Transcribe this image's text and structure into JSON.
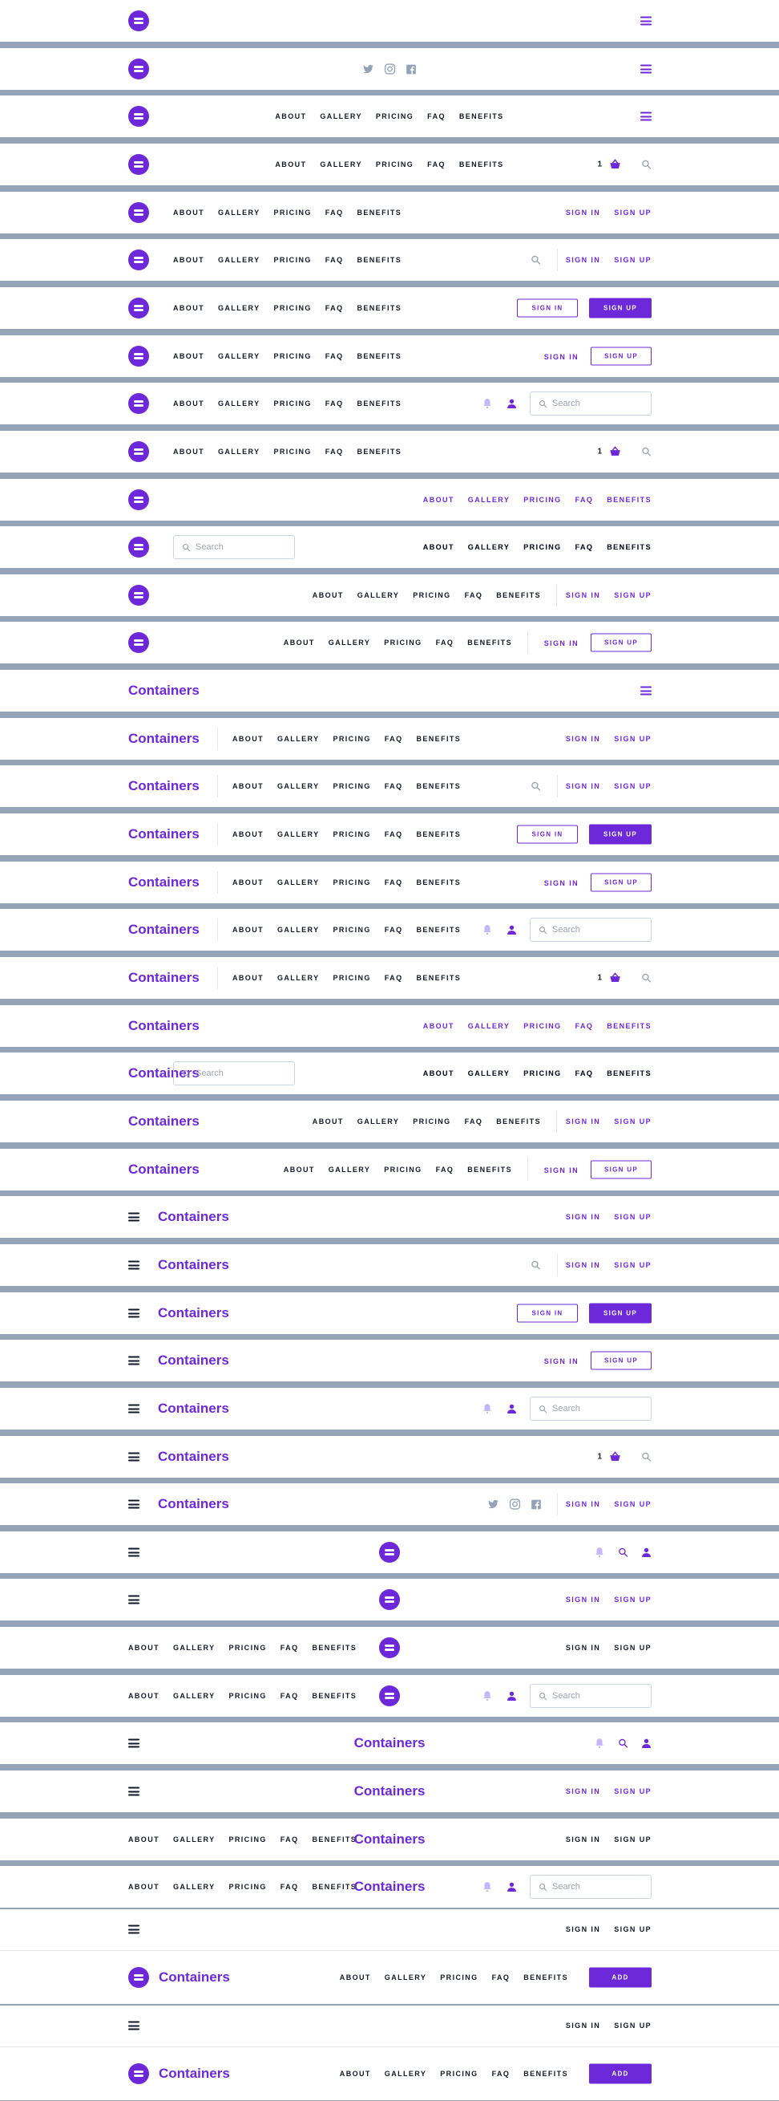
{
  "brand": {
    "name": "Containers"
  },
  "nav": {
    "items": [
      "ABOUT",
      "GALLERY",
      "PRICING",
      "FAQ",
      "BENEFITS"
    ]
  },
  "auth": {
    "sign_in": "SIGN IN",
    "sign_up": "SIGN UP",
    "add": "ADD"
  },
  "search": {
    "placeholder": "Search"
  },
  "cart": {
    "count": "1"
  },
  "icons": [
    "hamburger-icon",
    "twitter-icon",
    "instagram-icon",
    "facebook-icon",
    "cart-icon",
    "search-icon",
    "bell-icon",
    "user-icon"
  ],
  "colors": {
    "accent": "#6d28d9",
    "divider": "#94a3b8",
    "text": "#111827",
    "muted": "#9ca3af"
  },
  "layout_variants": [
    [
      "logo",
      "burger"
    ],
    [
      "logo",
      "social",
      "burger"
    ],
    [
      "logo",
      "menu-center",
      "burger"
    ],
    [
      "logo",
      "menu-center",
      "cart",
      "search"
    ],
    [
      "logo",
      "menu",
      "auth"
    ],
    [
      "logo",
      "menu",
      "search",
      "divider",
      "auth"
    ],
    [
      "logo",
      "menu",
      "btn-outline",
      "btn-filled"
    ],
    [
      "logo",
      "menu",
      "signin",
      "btn-signup"
    ],
    [
      "logo",
      "menu",
      "bell",
      "user",
      "searchbox"
    ],
    [
      "logo",
      "menu",
      "cart",
      "search"
    ],
    [
      "logo",
      "menu-right-purple"
    ],
    [
      "logo",
      "searchbox",
      "menu-right"
    ],
    [
      "logo",
      "menu-right",
      "divider",
      "auth"
    ],
    [
      "logo",
      "menu-right",
      "divider",
      "signin",
      "btn-signup"
    ],
    [
      "brand",
      "burger"
    ],
    [
      "brand",
      "divider",
      "menu",
      "auth"
    ],
    [
      "brand",
      "divider",
      "menu",
      "search",
      "divider",
      "auth"
    ],
    [
      "brand",
      "divider",
      "menu",
      "btn-outline",
      "btn-filled"
    ],
    [
      "brand",
      "divider",
      "menu",
      "signin",
      "btn-signup"
    ],
    [
      "brand",
      "divider",
      "menu",
      "bell",
      "user",
      "searchbox"
    ],
    [
      "brand",
      "divider",
      "menu",
      "cart",
      "search"
    ],
    [
      "brand",
      "menu-right-purple"
    ],
    [
      "brand",
      "searchbox",
      "menu-right"
    ],
    [
      "brand",
      "menu-right",
      "divider",
      "auth"
    ],
    [
      "brand",
      "menu-right",
      "divider",
      "signin",
      "btn-signup"
    ],
    [
      "burger",
      "brand",
      "auth"
    ],
    [
      "burger",
      "brand",
      "search",
      "divider",
      "auth"
    ],
    [
      "burger",
      "brand",
      "btn-outline",
      "btn-filled"
    ],
    [
      "burger",
      "brand",
      "signin",
      "btn-signup"
    ],
    [
      "burger",
      "brand",
      "bell",
      "user",
      "searchbox"
    ],
    [
      "burger",
      "brand",
      "cart",
      "search"
    ],
    [
      "burger",
      "brand",
      "social",
      "divider",
      "auth"
    ],
    [
      "burger",
      "logo-center",
      "bell",
      "search",
      "user"
    ],
    [
      "burger",
      "logo-center",
      "auth"
    ],
    [
      "menu-left",
      "logo-center",
      "auth-dark"
    ],
    [
      "menu-left",
      "logo-center",
      "bell",
      "user",
      "searchbox"
    ],
    [
      "burger",
      "brand-center",
      "bell",
      "search",
      "user"
    ],
    [
      "burger",
      "brand-center",
      "auth"
    ],
    [
      "menu-left",
      "brand-center",
      "auth-dark"
    ],
    [
      "menu-left",
      "brand-center",
      "bell",
      "user",
      "searchbox"
    ],
    [
      "burger",
      "auth-dark",
      "logo",
      "brand",
      "menu",
      "btn-add"
    ],
    [
      "burger",
      "auth-dark",
      "logo",
      "brand",
      "menu",
      "btn-add"
    ]
  ]
}
